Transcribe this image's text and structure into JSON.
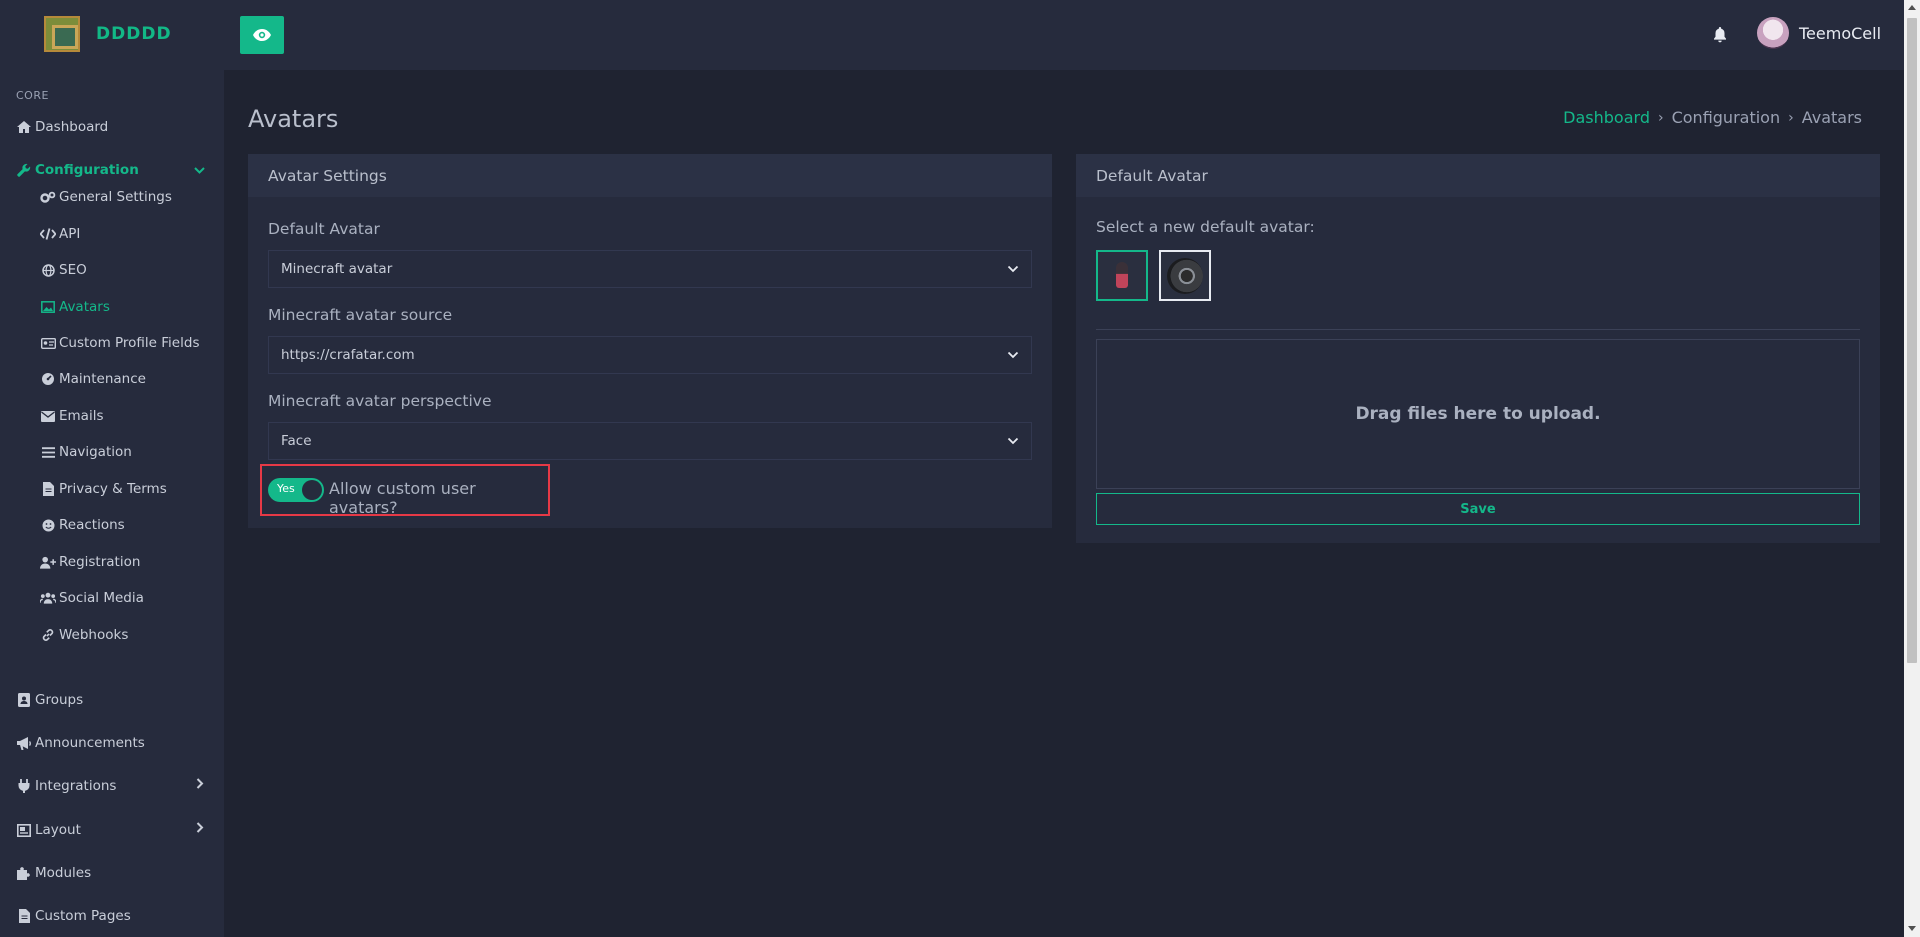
{
  "brand": {
    "name": "DDDDD"
  },
  "header": {
    "user_name": "TeemoCell"
  },
  "sidebar": {
    "section": "CORE",
    "dashboard": "Dashboard",
    "configuration": "Configuration",
    "config_items": [
      "General Settings",
      "API",
      "SEO",
      "Avatars",
      "Custom Profile Fields",
      "Maintenance",
      "Emails",
      "Navigation",
      "Privacy & Terms",
      "Reactions",
      "Registration",
      "Social Media",
      "Webhooks"
    ],
    "bottom_items": [
      "Groups",
      "Announcements",
      "Integrations",
      "Layout",
      "Modules",
      "Custom Pages"
    ]
  },
  "page": {
    "title": "Avatars",
    "breadcrumb": [
      "Dashboard",
      "Configuration",
      "Avatars"
    ]
  },
  "avatar_settings": {
    "header": "Avatar Settings",
    "default_avatar_label": "Default Avatar",
    "default_avatar_value": "Minecraft avatar",
    "source_label": "Minecraft avatar source",
    "source_value": "https://crafatar.com",
    "perspective_label": "Minecraft avatar perspective",
    "perspective_value": "Face",
    "toggle_text": "Yes",
    "toggle_label": "Allow custom user avatars?"
  },
  "default_avatar": {
    "header": "Default Avatar",
    "select_label": "Select a new default avatar:",
    "dropzone_text": "Drag files here to upload.",
    "save_label": "Save"
  },
  "colors": {
    "accent": "#14b88a",
    "highlight_border": "#e63946",
    "background": "#1f2331",
    "panel": "#262b3d"
  }
}
